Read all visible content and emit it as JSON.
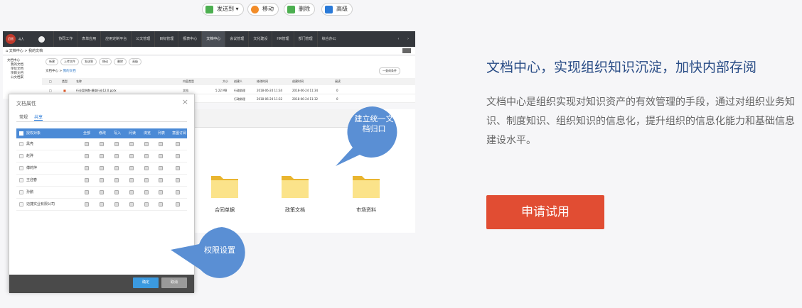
{
  "topbar": {
    "avatar_text": "迈巡",
    "user_label": "4人",
    "nav": [
      "协同工作",
      "表单应用",
      "应用定制平台",
      "公文管理",
      "目标管理",
      "报表中心",
      "文档中心",
      "会议管理",
      "文化建设",
      "HR管理",
      "部门管理",
      "综合办公"
    ],
    "active_nav": "文档中心",
    "arrows": "‹ ›"
  },
  "breadcrumb": "文档中心 > 我的文档",
  "sidebar": {
    "items": [
      "文档中心",
      "我的文档",
      "单位文档",
      "项目文档",
      "公文档案"
    ]
  },
  "toolbar": {
    "buttons": [
      "新建",
      "上传文件",
      "发送到",
      "移动",
      "删除",
      "高级"
    ]
  },
  "list": {
    "crumb_root": "文档中心",
    "crumb_current": "我的文档",
    "filter": "一查询条件",
    "headers": [
      "类型",
      "名称",
      "内容类型",
      "大小",
      "创建人",
      "修改时间",
      "创建时间",
      "阅读"
    ],
    "rows": [
      {
        "name": "行业案例数-模拟行业12.0.pptx",
        "type": "文档",
        "size": "5.22 MB",
        "creator": "行政助理",
        "modified": "2018-06-24 11:34",
        "created": "2018-06-24 11:34",
        "reads": "0"
      },
      {
        "name": "",
        "type": "",
        "size": "",
        "creator": "行政助理",
        "modified": "2018-06-24 11:32",
        "created": "2018-06-24 11:32",
        "reads": "0"
      }
    ]
  },
  "dialog": {
    "title": "文档属性",
    "close": "×",
    "tabs": [
      "常规",
      "共享"
    ],
    "active_tab": "共享",
    "columns": [
      "授权对象",
      "全部",
      "修改",
      "写入",
      "问读",
      "浏览",
      "列表",
      "意图订阅"
    ],
    "rows": [
      "黑亮",
      "赵骅",
      "傅莉萍",
      "王迎春",
      "孙鹏",
      "迈捷实业有限公司"
    ],
    "ok": "确定",
    "cancel": "取消"
  },
  "panel": {
    "buttons": [
      "发送到 ▾",
      "移动",
      "删除",
      "高级"
    ],
    "folders": [
      "合同单据",
      "政策文档",
      "市场资料"
    ]
  },
  "bubbles": {
    "unified": "建立统一文档归口",
    "permission": "权限设置"
  },
  "feature": {
    "title": "文档中心，实现组织知识沉淀，加快内部存阅",
    "description": "文档中心是组织实现对知识资产的有效管理的手段，通过对组织业务知识、制度知识、组织知识的信息化，提升组织的信息化能力和基础信息建设水平。",
    "cta": "申请试用"
  },
  "colors": {
    "accent_blue": "#4b8ad6",
    "title_blue": "#2a4d86",
    "cta_red": "#e14d33",
    "folder_yellow": "#f5c842"
  }
}
